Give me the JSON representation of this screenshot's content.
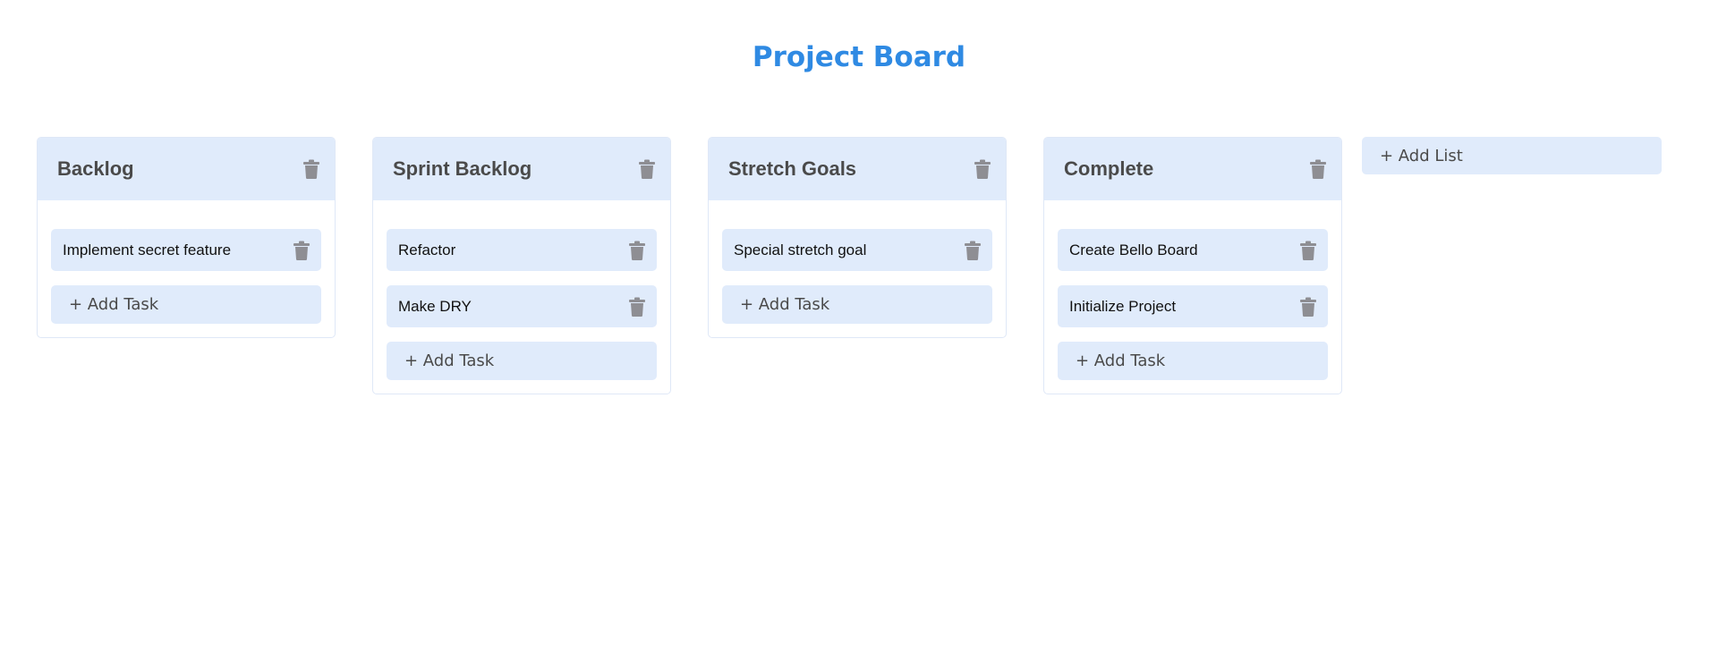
{
  "page": {
    "title": "Project Board"
  },
  "colors": {
    "title": "#2f8ae3",
    "card_bg": "#e0ebfb",
    "trash_icon": "#8e8e93"
  },
  "lists": [
    {
      "title": "Backlog",
      "tasks": [
        "Implement secret feature"
      ],
      "add_task_label": "+ Add Task"
    },
    {
      "title": "Sprint Backlog",
      "tasks": [
        "Refactor",
        "Make DRY"
      ],
      "add_task_label": "+ Add Task"
    },
    {
      "title": "Stretch Goals",
      "tasks": [
        "Special stretch goal"
      ],
      "add_task_label": "+ Add Task"
    },
    {
      "title": "Complete",
      "tasks": [
        "Create Bello Board",
        "Initialize Project"
      ],
      "add_task_label": "+ Add Task"
    }
  ],
  "add_list_label": "+ Add List",
  "icons": {
    "delete": "trash-icon"
  }
}
